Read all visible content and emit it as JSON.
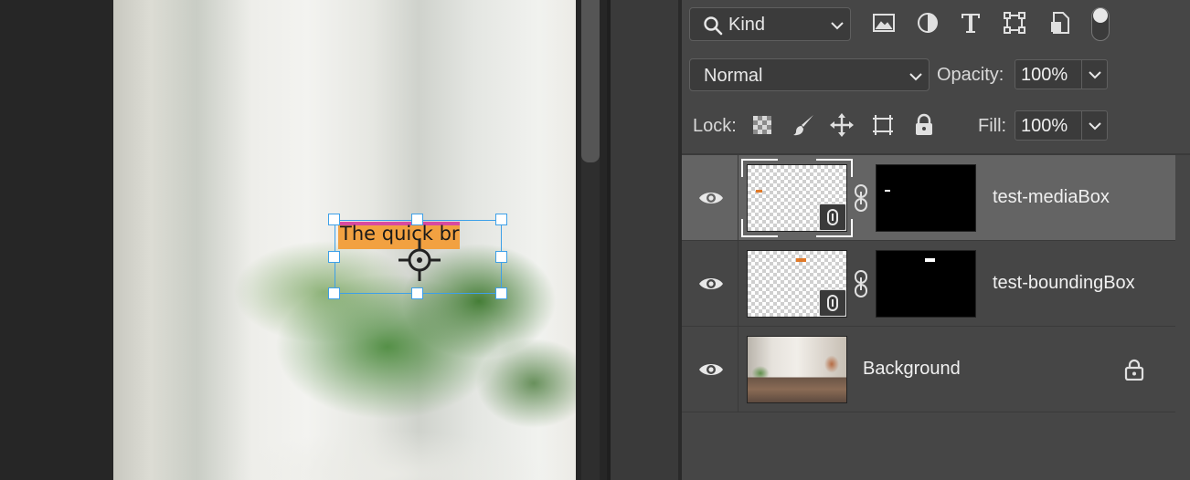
{
  "canvas": {
    "text_layer_content": "The quick bro"
  },
  "layers_panel": {
    "filter": {
      "kind_label": "Kind",
      "filter_icons": [
        "image-filter-icon",
        "adjustment-filter-icon",
        "type-filter-icon",
        "shape-filter-icon",
        "smart-object-filter-icon"
      ]
    },
    "blend_mode": "Normal",
    "opacity_label": "Opacity:",
    "opacity_value": "100%",
    "lock_label": "Lock:",
    "lock_icons": [
      "lock-transparent-pixels-icon",
      "lock-image-pixels-icon",
      "lock-position-icon",
      "lock-artboard-icon",
      "lock-all-icon"
    ],
    "fill_label": "Fill:",
    "fill_value": "100%",
    "layers": [
      {
        "name": "test-mediaBox",
        "selected": true,
        "type": "smart-object-with-mask"
      },
      {
        "name": "test-boundingBox",
        "selected": false,
        "type": "smart-object-with-mask"
      },
      {
        "name": "Background",
        "selected": false,
        "type": "background",
        "locked": true
      }
    ]
  },
  "colors": {
    "selection_accent": "#3da0e8",
    "panel_bg": "#464646",
    "selected_row": "#646464",
    "text_highlight_orange": "#f2a141",
    "text_highlight_pink": "#d94aa0"
  }
}
